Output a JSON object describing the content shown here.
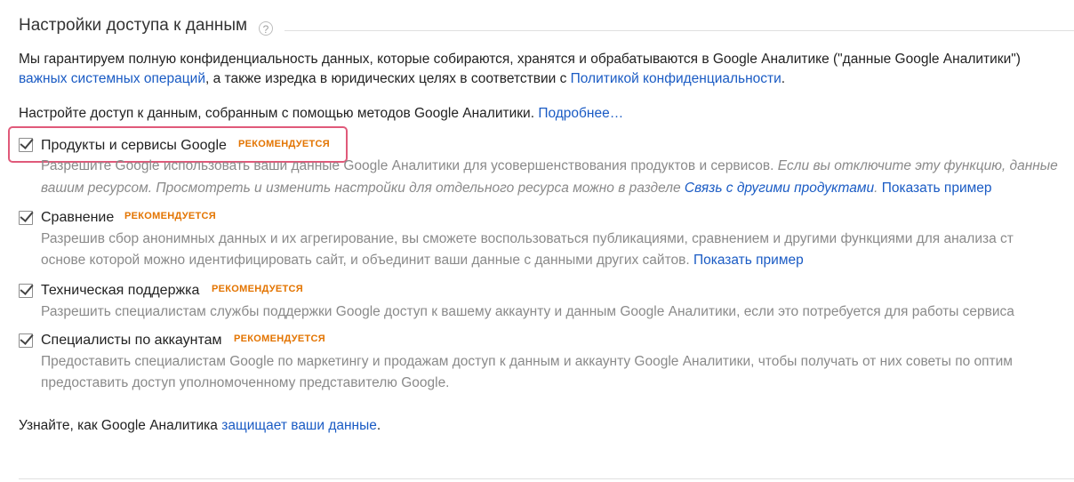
{
  "header": {
    "title": "Настройки доступа к данным",
    "help_icon": "?"
  },
  "intro": {
    "line1": "Мы гарантируем полную конфиденциальность данных, которые собираются, хранятся и обрабатываются в Google Аналитике (\"данные Google Аналитики\")",
    "line2_link": "важных системных операций",
    "line2_text": ", а также изредка в юридических целях в соответствии с ",
    "line2_link2": "Политикой конфиденциальности",
    "line2_end": "."
  },
  "configure": {
    "text": "Настройте доступ к данным, собранным с помощью методов Google Аналитики. ",
    "link": "Подробнее…"
  },
  "options": [
    {
      "title": "Продукты и сервисы Google",
      "badge": "РЕКОМЕНДУЕТСЯ",
      "checked": true,
      "line1_text": "Разрешите Google использовать ваши данные Google Аналитики для усовершенствования продуктов и сервисов. ",
      "line1_italic": "Если вы отключите эту функцию, данные",
      "line2_italic": "вашим ресурсом. Просмотреть и изменить настройки для отдельного ресурса можно в разделе ",
      "line2_link_italic": "Связь с другими продуктами",
      "line2_dot": ".",
      "line2_link": " Показать пример"
    },
    {
      "title": "Сравнение",
      "badge": "РЕКОМЕНДУЕТСЯ",
      "checked": true,
      "line1_text": "Разрешив сбор анонимных данных и их агрегирование, вы сможете воспользоваться публикациями, сравнением и другими функциями для анализа ст",
      "line2_text": "основе которой можно идентифицировать сайт, и объединит ваши данные с данными других сайтов. ",
      "line2_link": "Показать пример"
    },
    {
      "title": "Техническая поддержка",
      "badge": "РЕКОМЕНДУЕТСЯ",
      "checked": true,
      "line1_text": "Разрешить специалистам службы поддержки Google доступ к вашему аккаунту и данным Google Аналитики, если это потребуется для работы сервиса"
    },
    {
      "title": "Специалисты по аккаунтам",
      "badge": "РЕКОМЕНДУЕТСЯ",
      "checked": true,
      "line1_text": "Предоставить специалистам Google по маркетингу и продажам доступ к данным и аккаунту Google Аналитики, чтобы получать от них советы по оптим",
      "line2_text": "предоставить доступ уполномоченному представителю Google."
    }
  ],
  "footer": {
    "text": "Узнайте, как Google Аналитика ",
    "link": "защищает ваши данные",
    "end": "."
  },
  "colors": {
    "link": "#1a5bc4",
    "badge": "#e37400",
    "highlight": "#e05a7a",
    "muted_text": "#8a8a8a"
  }
}
